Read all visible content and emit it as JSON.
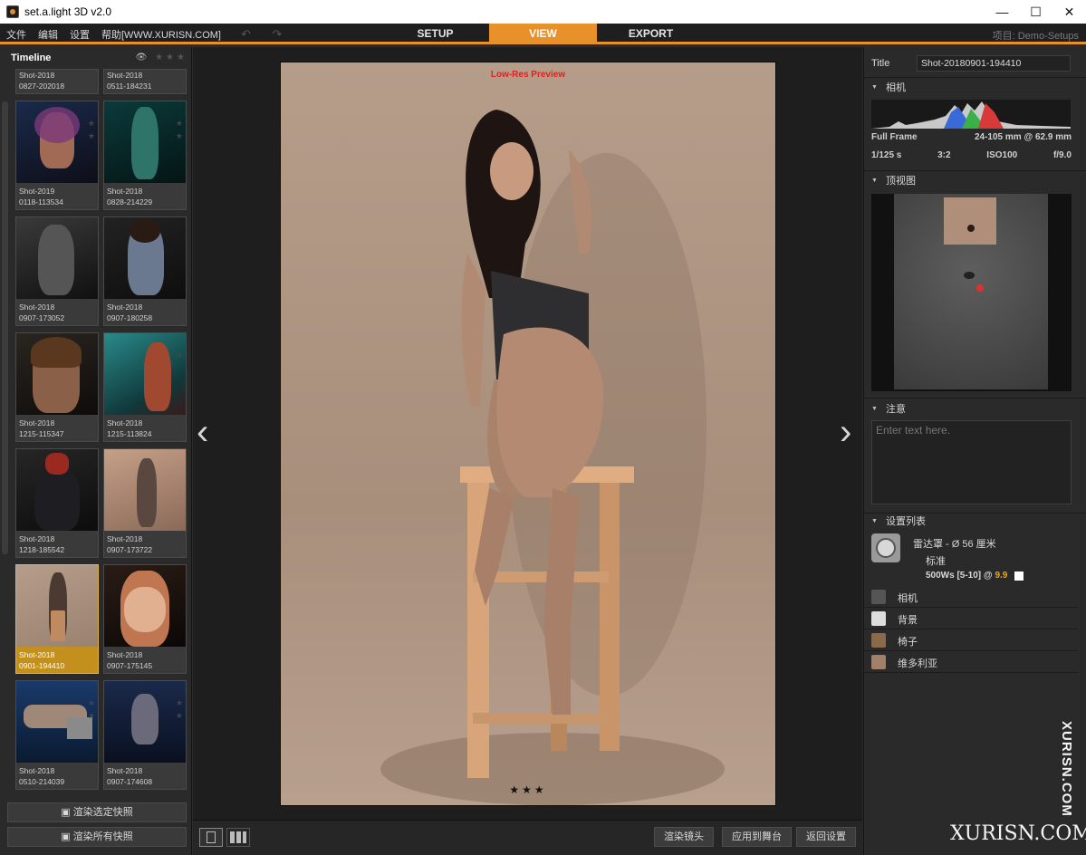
{
  "window": {
    "title": "set.a.light 3D v2.0",
    "controls": [
      "—",
      "☐",
      "✕"
    ]
  },
  "menu": {
    "items": [
      "文件",
      "编辑",
      "设置",
      "帮助[WWW.XURISN.COM]"
    ],
    "undo": "↶ ↷"
  },
  "tabs": [
    {
      "label": "SETUP"
    },
    {
      "label": "VIEW",
      "active": true
    },
    {
      "label": "EXPORT"
    }
  ],
  "project": "项目: Demo-Setups",
  "timeline": {
    "title": "Timeline",
    "eye_icon": "eye-icon",
    "filter_stars": "★★★",
    "thumbs": [
      {
        "line1": "Shot-2018",
        "line2": "0827-202018"
      },
      {
        "line1": "Shot-2018",
        "line2": "0511-184231"
      },
      {
        "line1": "Shot-2019",
        "line2": "0118-113534"
      },
      {
        "line1": "Shot-2018",
        "line2": "0828-214229"
      },
      {
        "line1": "Shot-2018",
        "line2": "0907-173052"
      },
      {
        "line1": "Shot-2018",
        "line2": "0907-180258"
      },
      {
        "line1": "Shot-2018",
        "line2": "1215-115347"
      },
      {
        "line1": "Shot-2018",
        "line2": "1215-113824"
      },
      {
        "line1": "Shot-2018",
        "line2": "1218-185542"
      },
      {
        "line1": "Shot-2018",
        "line2": "0907-173722"
      },
      {
        "line1": "Shot-2018",
        "line2": "0901-194410",
        "selected": true
      },
      {
        "line1": "Shot-2018",
        "line2": "0907-175145"
      },
      {
        "line1": "Shot-2018",
        "line2": "0510-214039"
      },
      {
        "line1": "Shot-2018",
        "line2": "0907-174608"
      }
    ],
    "render_selected": "渲染选定快照",
    "render_all": "渲染所有快照"
  },
  "preview": {
    "overlay": "Low-Res Preview",
    "prev": "‹",
    "next": "›",
    "rating": "★★★"
  },
  "bottom": {
    "render_camera": "渲染镜头",
    "apply_stage": "应用到舞台",
    "back_setup": "返回设置"
  },
  "inspector": {
    "title_label": "Title",
    "title_value": "Shot-20180901-194410",
    "camera_section": "相机",
    "sensor": "Full Frame",
    "lens": "24-105 mm @ 62.9 mm",
    "shutter": "1/125 s",
    "ratio": "3:2",
    "iso": "ISO100",
    "aperture": "f/9.0",
    "topview_section": "顶视图",
    "notes_section": "注意",
    "notes_placeholder": "Enter text here.",
    "setup_section": "设置列表",
    "light_name": "雷达罩 - Ø 56 厘米",
    "light_mode": "标准",
    "light_power": "500Ws [5-10] @ ",
    "light_power_value": "9.9",
    "items": [
      {
        "label": "相机"
      },
      {
        "label": "背景"
      },
      {
        "label": "椅子"
      },
      {
        "label": "维多利亚"
      }
    ]
  },
  "watermark": {
    "vertical": "XURISN.COM",
    "bottom": "XURISN.COM"
  }
}
